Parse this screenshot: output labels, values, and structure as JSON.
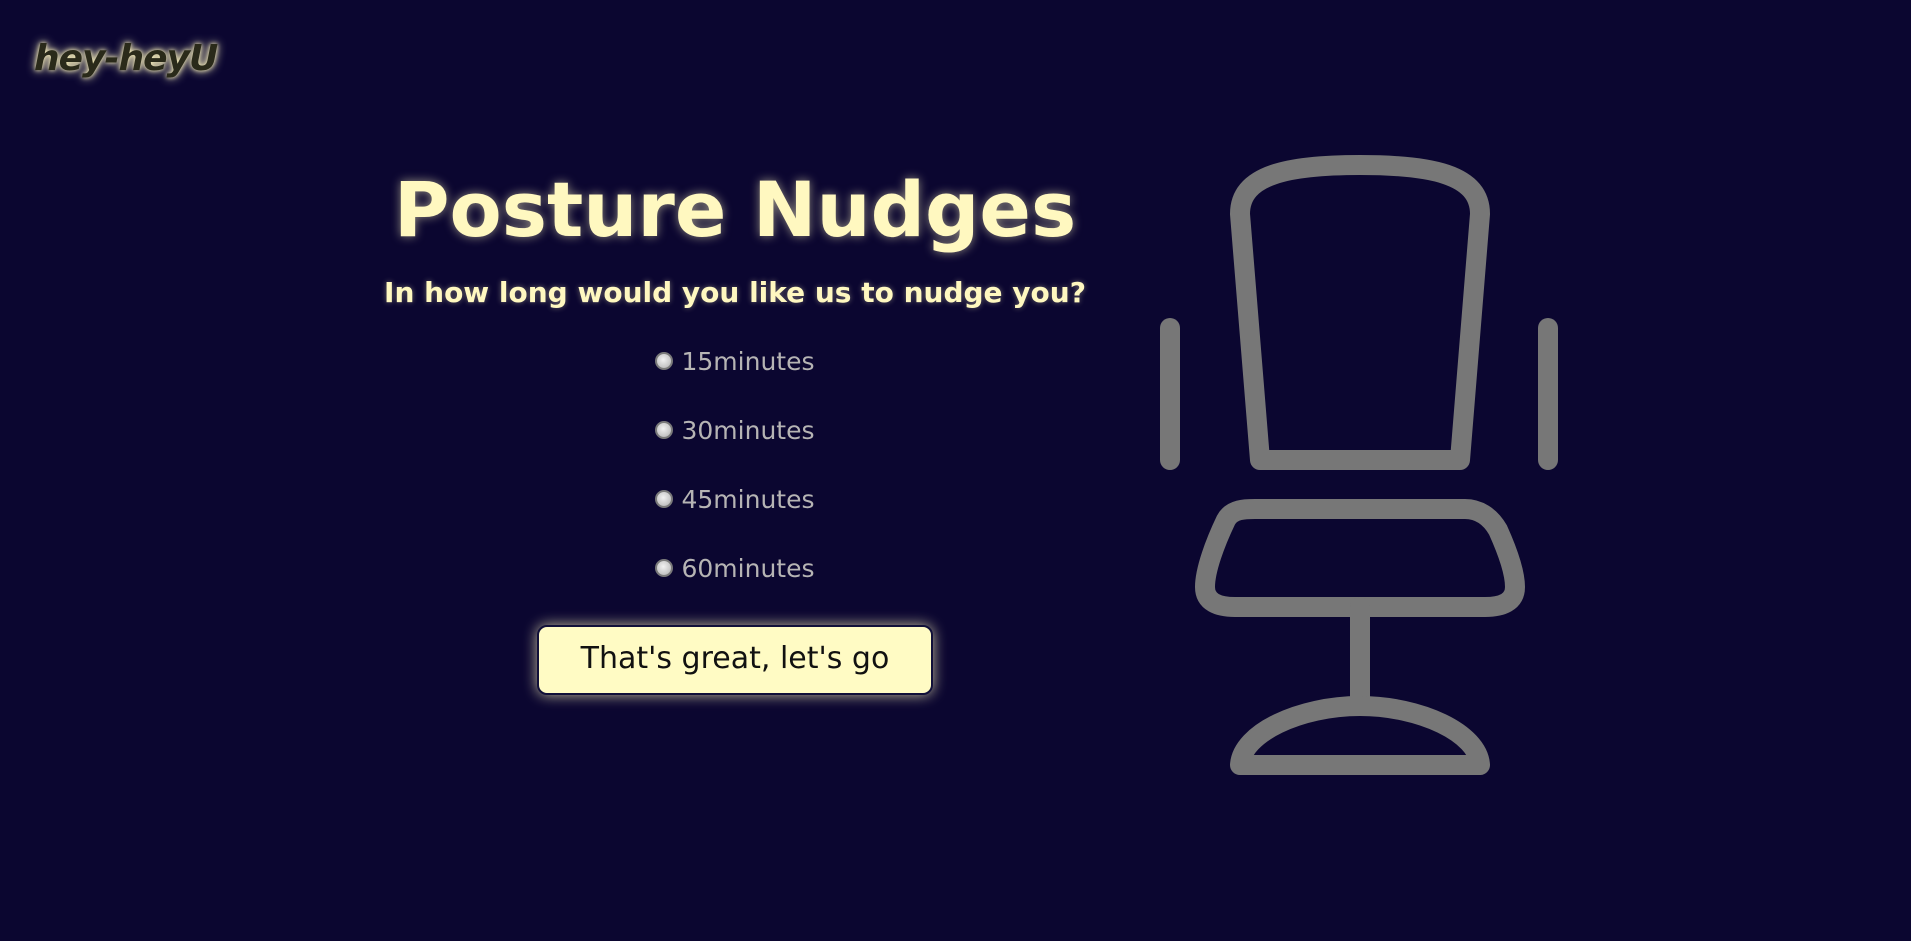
{
  "logo": {
    "text": "hey-heyU"
  },
  "main": {
    "title": "Posture Nudges",
    "question": "In how long would you like us to nudge you?",
    "options": [
      {
        "label": "15minutes"
      },
      {
        "label": "30minutes"
      },
      {
        "label": "45minutes"
      },
      {
        "label": "60minutes"
      }
    ],
    "submit_label": "That's great, let's go"
  },
  "illustration": {
    "icon": "office-chair-icon"
  },
  "colors": {
    "background": "#0b0630",
    "accent": "#fff8c0",
    "option_text": "#b6b4b4",
    "chair": "#777777"
  }
}
